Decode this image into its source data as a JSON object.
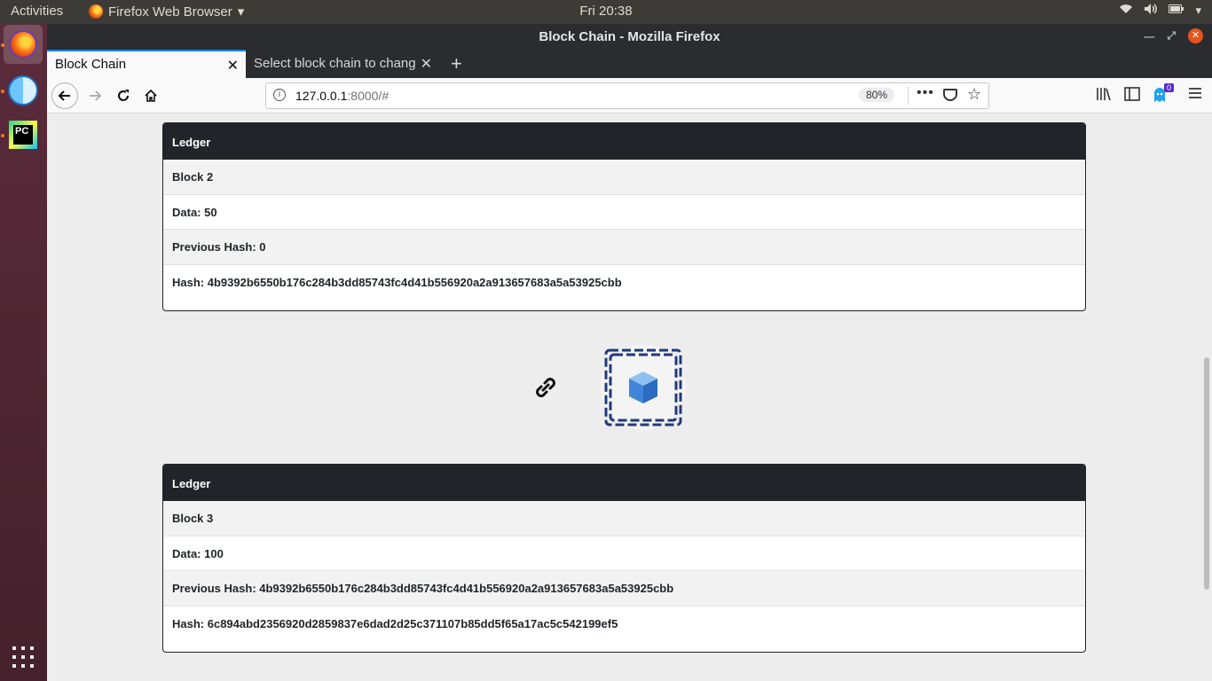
{
  "system": {
    "activities_label": "Activities",
    "app_menu_label": "Firefox Web Browser",
    "clock": "Fri 20:38"
  },
  "window": {
    "title": "Block Chain - Mozilla Firefox"
  },
  "tabs": [
    {
      "label": "Block Chain",
      "active": true
    },
    {
      "label": "Select block chain to change",
      "active": false
    }
  ],
  "urlbar": {
    "host": "127.0.0.1",
    "path": ":8000/#",
    "zoom": "80%"
  },
  "toolbar": {
    "notifications_badge": "0"
  },
  "ledgers": [
    {
      "header": "Ledger",
      "block": "Block 2",
      "data": "Data: 50",
      "previous_hash": "Previous Hash: 0",
      "hash": "Hash: 4b9392b6550b176c284b3dd85743fc4d41b556920a2a913657683a5a53925cbb"
    },
    {
      "header": "Ledger",
      "block": "Block 3",
      "data": "Data: 100",
      "previous_hash": "Previous Hash: 4b9392b6550b176c284b3dd85743fc4d41b556920a2a913657683a5a53925cbb",
      "hash": "Hash: 6c894abd2356920d2859837e6dad2d25c371107b85dd5f65a17ac5c542199ef5"
    }
  ],
  "colors": {
    "card_header": "#212529",
    "accent_tab": "#0a84ff",
    "chain_blue": "#1f3a7a",
    "cube_blue": "#3f86d9"
  }
}
